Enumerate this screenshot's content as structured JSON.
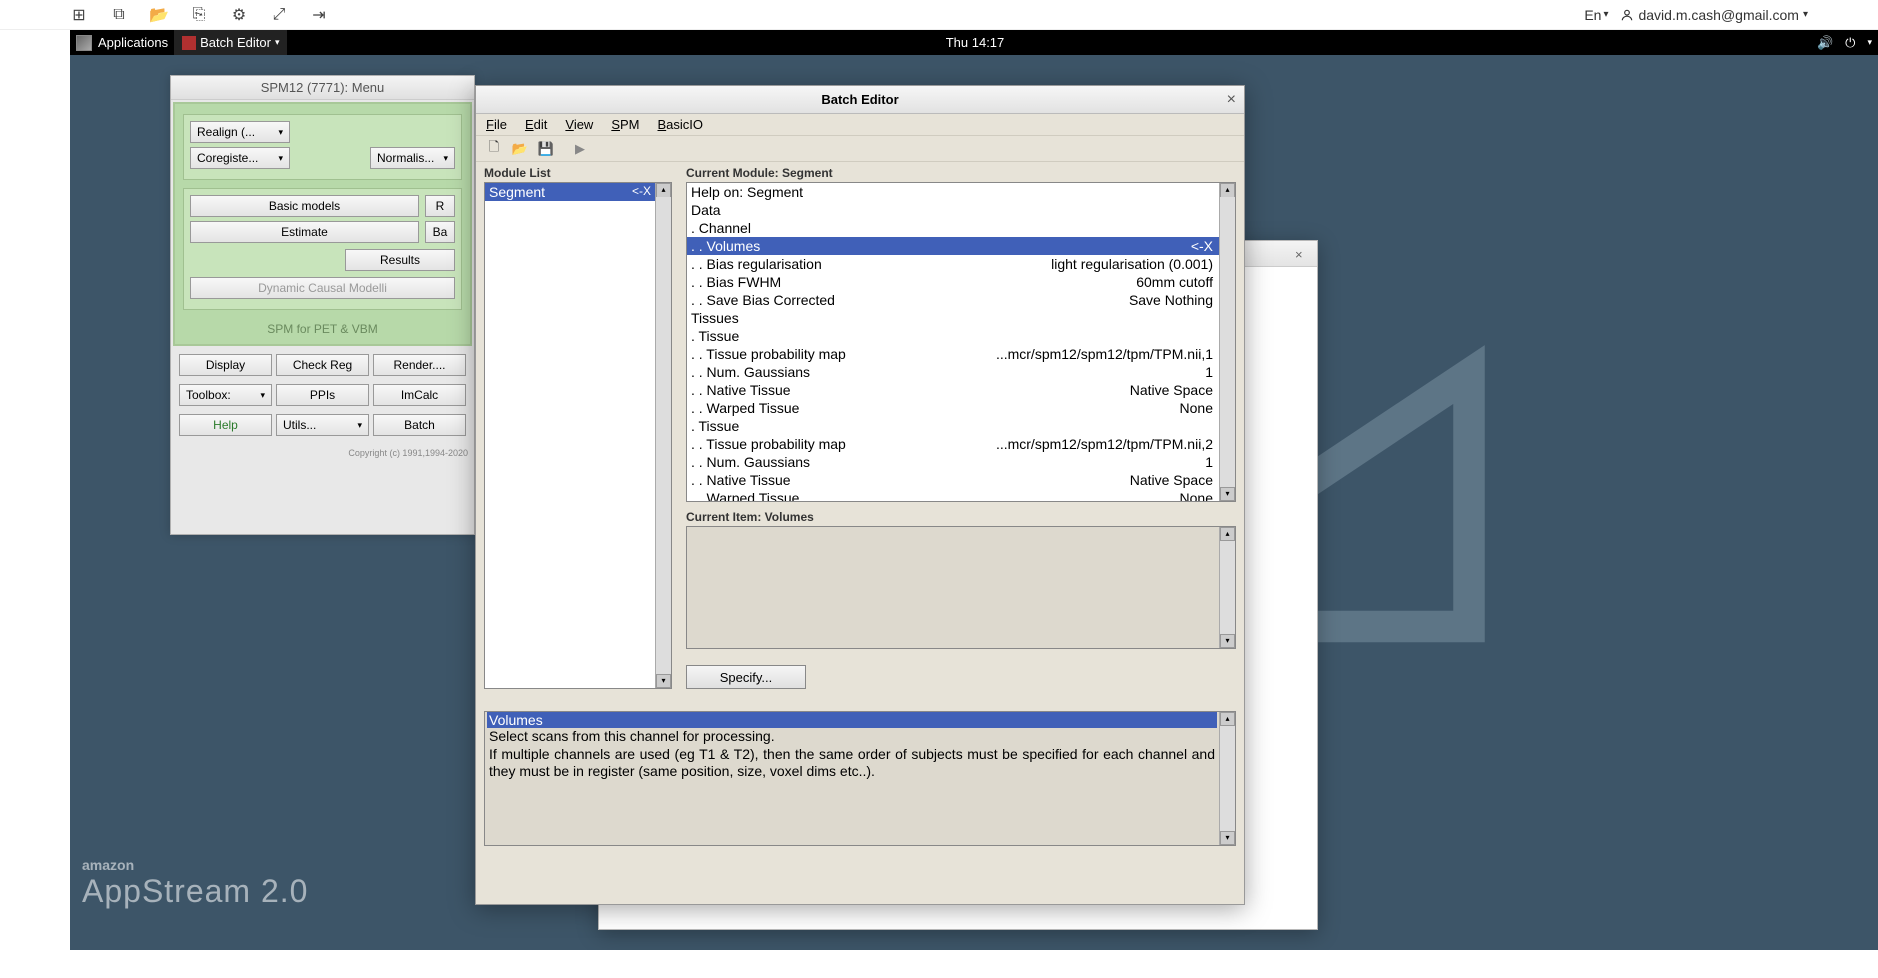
{
  "topbar": {
    "lang": "En",
    "user": "david.m.cash@gmail.com"
  },
  "sysbar": {
    "applications": "Applications",
    "task_batch": "Batch Editor",
    "clock": "Thu 14:17"
  },
  "watermark": {
    "brand_small": "amazon",
    "brand_big": "AppStream 2.0"
  },
  "spm": {
    "title": "SPM12 (7771): Menu",
    "realign": "Realign (...",
    "normalise": "Normalis...",
    "coregister": "Coregiste...",
    "basic_models": "Basic models",
    "r_btn": "R",
    "estimate": "Estimate",
    "ba_btn": "Ba",
    "results": "Results",
    "dcm": "Dynamic Causal Modelli",
    "footer": "SPM for PET & VBM",
    "display": "Display",
    "checkreg": "Check Reg",
    "render": "Render....",
    "toolbox": "Toolbox:",
    "ppis": "PPIs",
    "imcalc": "ImCalc",
    "help": "Help",
    "utils": "Utils...",
    "batch": "Batch",
    "copyright": "Copyright (c) 1991,1994-2020"
  },
  "batch": {
    "title": "Batch Editor",
    "menus": {
      "file": "File",
      "edit": "Edit",
      "view": "View",
      "spm": "SPM",
      "basicio": "BasicIO"
    },
    "module_list_label": "Module List",
    "module_item": "Segment",
    "module_arrow": "<-X",
    "current_module_label": "Current Module: Segment",
    "tree": [
      {
        "l": "Help on: Segment",
        "v": ""
      },
      {
        "l": "Data",
        "v": ""
      },
      {
        "l": ". Channel",
        "v": ""
      },
      {
        "l": ". . Volumes",
        "v": "<-X",
        "sel": true
      },
      {
        "l": ". . Bias regularisation",
        "v": "light regularisation (0.001)"
      },
      {
        "l": ". . Bias FWHM",
        "v": "60mm cutoff"
      },
      {
        "l": ". . Save Bias Corrected",
        "v": "Save Nothing"
      },
      {
        "l": "Tissues",
        "v": ""
      },
      {
        "l": ". Tissue",
        "v": ""
      },
      {
        "l": ". . Tissue probability map",
        "v": "...mcr/spm12/spm12/tpm/TPM.nii,1"
      },
      {
        "l": ". . Num. Gaussians",
        "v": "1"
      },
      {
        "l": ". . Native Tissue",
        "v": "Native Space"
      },
      {
        "l": ". . Warped Tissue",
        "v": "None"
      },
      {
        "l": ". Tissue",
        "v": ""
      },
      {
        "l": ". . Tissue probability map",
        "v": "...mcr/spm12/spm12/tpm/TPM.nii,2"
      },
      {
        "l": ". . Num. Gaussians",
        "v": "1"
      },
      {
        "l": ". . Native Tissue",
        "v": "Native Space"
      },
      {
        "l": ". . Warped Tissue",
        "v": "None"
      }
    ],
    "current_item_label": "Current Item: Volumes",
    "specify": "Specify...",
    "help_title": "Volumes",
    "help_line1": "Select scans from this channel for processing.",
    "help_line2": "If multiple channels are used (eg T1 & T2), then the same order of subjects must be specified for each channel and they must be in register (same position, size, voxel dims etc..)."
  }
}
